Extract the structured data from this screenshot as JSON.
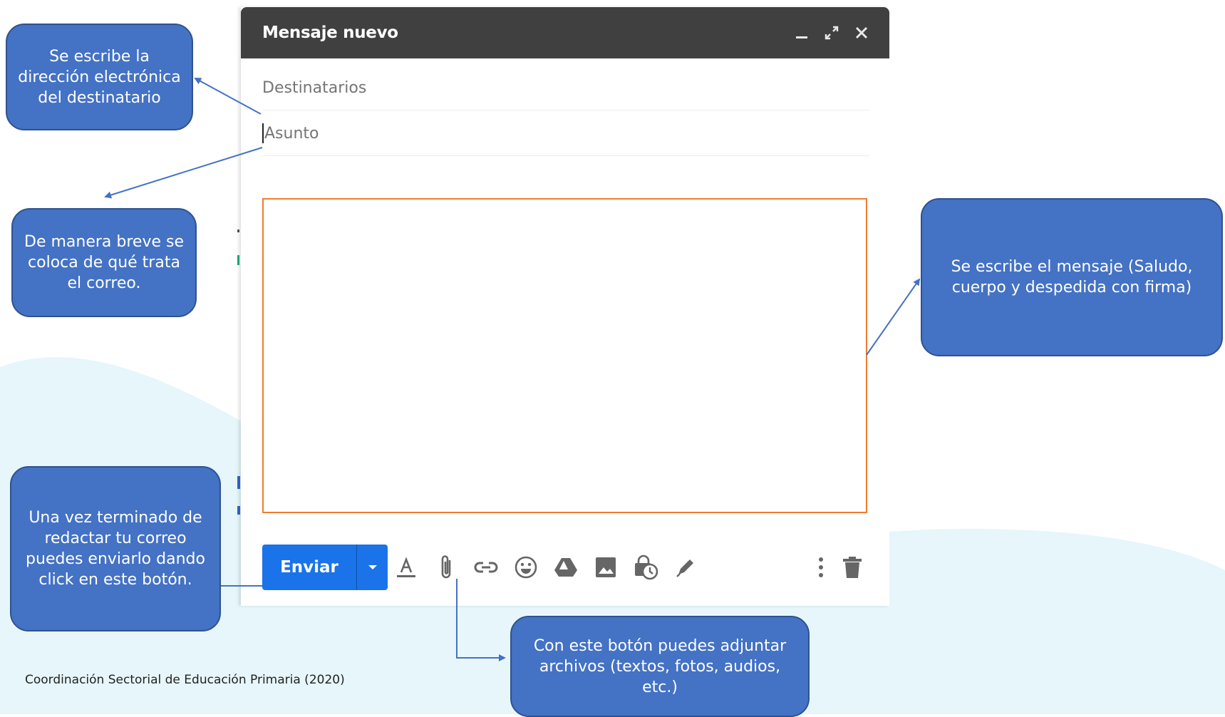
{
  "compose": {
    "title": "Mensaje nuevo",
    "recipients_placeholder": "Destinatarios",
    "subject_placeholder": "Asunto",
    "body_value": "",
    "send_label": "Enviar",
    "titlebar_bg": "#404040",
    "send_color": "#1a73e8",
    "highlight_color": "#ed7d31",
    "window_controls": [
      "minimize-icon",
      "expand-icon",
      "close-icon"
    ],
    "toolbar_icons": [
      "format-text-icon",
      "paperclip-icon",
      "link-icon",
      "emoji-icon",
      "drive-icon",
      "image-icon",
      "confidential-mode-icon",
      "signature-pen-icon",
      "more-options-icon",
      "trash-icon"
    ]
  },
  "callouts": {
    "recipient": "Se escribe la dirección electrónica del destinatario",
    "subject": "De manera breve se coloca de qué trata el correo.",
    "message": "Se escribe el mensaje (Saludo, cuerpo y despedida con firma)",
    "send": "Una vez terminado de redactar tu correo puedes enviarlo dando click en este botón.",
    "attach": "Con este botón puedes adjuntar archivos (textos, fotos, audios, etc.)",
    "fill_color": "#4472c4"
  },
  "footer": {
    "credit": "Coordinación Sectorial de Educación Primaria (2020)"
  }
}
